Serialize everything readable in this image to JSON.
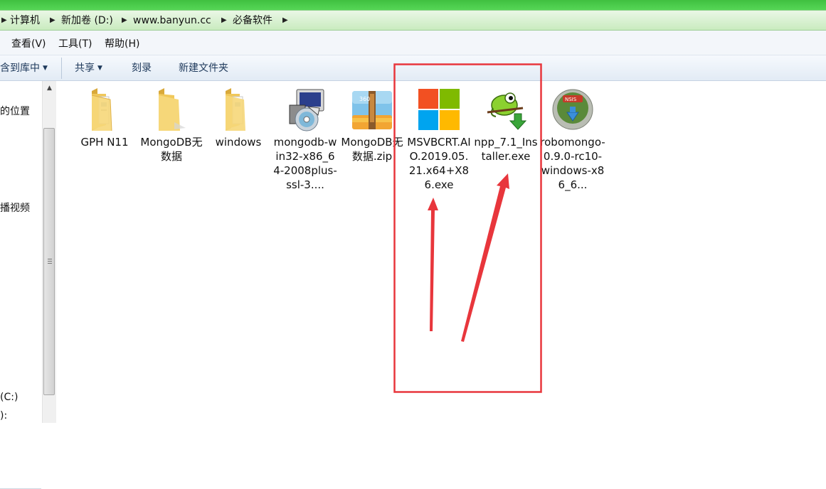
{
  "breadcrumb": {
    "items": [
      "计算机",
      "新加卷 (D:)",
      "www.banyun.cc",
      "必备软件"
    ]
  },
  "menu": {
    "items": [
      "查看(V)",
      "工具(T)",
      "帮助(H)"
    ]
  },
  "toolbar": {
    "include_library": "含到库中",
    "share": "共享",
    "burn": "刻录",
    "new_folder": "新建文件夹"
  },
  "nav": {
    "items": [
      "的位置",
      "播视频",
      "(C:)",
      "):"
    ]
  },
  "files": [
    {
      "name": "GPH N11",
      "icon": "folder-icon"
    },
    {
      "name": "MongoDB无数据",
      "icon": "folder-icon"
    },
    {
      "name": "windows",
      "icon": "folder-icon"
    },
    {
      "name": "mongodb-win32-x86_64-2008plus-ssl-3....",
      "icon": "installer-cd-icon"
    },
    {
      "name": "MongoDB无数据.zip",
      "icon": "zip-archive-icon"
    },
    {
      "name": "MSVBCRT.AIO.2019.05.21.x64+X86.exe",
      "icon": "windows-logo-icon"
    },
    {
      "name": "npp_7.1_Installer.exe",
      "icon": "notepadpp-chameleon-icon"
    },
    {
      "name": "robomongo-0.9.0-rc10-windows-x86_6...",
      "icon": "nsis-installer-icon"
    }
  ],
  "colors": {
    "annotation_red": "#e8363c",
    "title_green": "#4ccc4c",
    "toolbar_text": "#1e395b"
  }
}
